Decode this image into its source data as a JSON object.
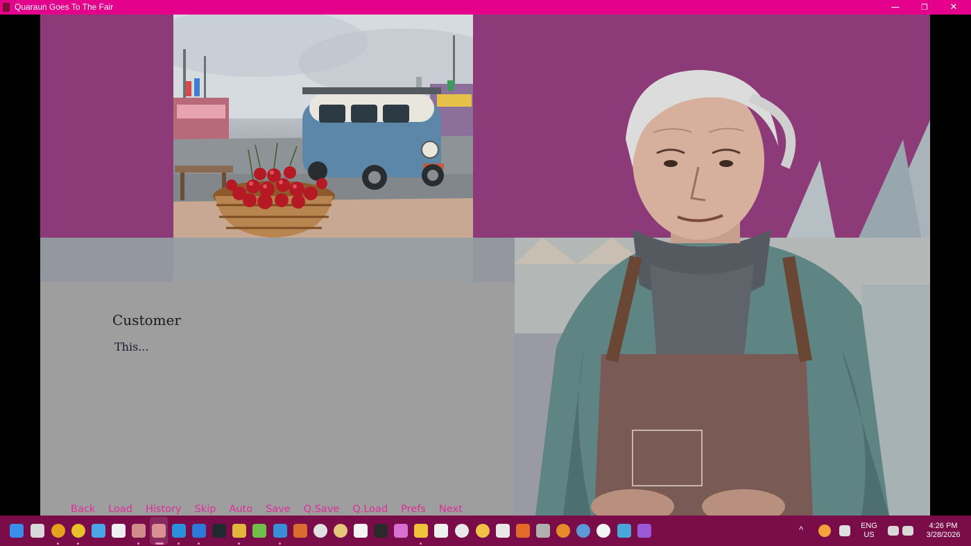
{
  "window": {
    "title": "Quaraun Goes To The Fair",
    "minimize_glyph": "—",
    "maximize_glyph": "❐",
    "close_glyph": "✕"
  },
  "dialogue": {
    "speaker": "Customer",
    "text": "This..."
  },
  "quick_menu": [
    "Back",
    "Load",
    "History",
    "Skip",
    "Auto",
    "Save",
    "Q.Save",
    "Q.Load",
    "Prefs",
    "Next"
  ],
  "taskbar": {
    "language_top": "ENG",
    "language_bottom": "US",
    "time": "4:26 PM",
    "date": "3/28/2026",
    "tray_chevron": "^"
  },
  "colors": {
    "accent": "#e5008c",
    "game_bg": "#8c3a78",
    "menu_text": "#e02a9a",
    "taskbar": "#7a0c4a"
  }
}
